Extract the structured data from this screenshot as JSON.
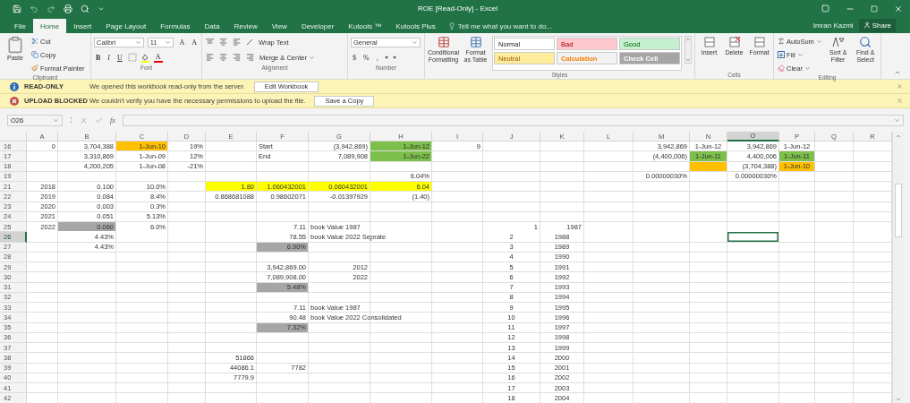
{
  "window": {
    "title": "ROE  [Read-Only] - Excel"
  },
  "tabs": [
    {
      "label": "File",
      "selected": false
    },
    {
      "label": "Home",
      "selected": true
    },
    {
      "label": "Insert",
      "selected": false
    },
    {
      "label": "Page Layout",
      "selected": false
    },
    {
      "label": "Formulas",
      "selected": false
    },
    {
      "label": "Data",
      "selected": false
    },
    {
      "label": "Review",
      "selected": false
    },
    {
      "label": "View",
      "selected": false
    },
    {
      "label": "Developer",
      "selected": false
    },
    {
      "label": "Kutools ™",
      "selected": false
    },
    {
      "label": "Kutools Plus",
      "selected": false
    }
  ],
  "tell_me": {
    "placeholder": "Tell me what you want to do..."
  },
  "user": {
    "name": "Imran Kazmi",
    "share": "Share"
  },
  "ribbon": {
    "clipboard": {
      "label": "Clipboard",
      "paste": "Paste",
      "cut": "Cut",
      "copy": "Copy",
      "format_painter": "Format Painter"
    },
    "font": {
      "label": "Font",
      "name": "Calibri",
      "size": "11",
      "grow": "A",
      "shrink": "A",
      "bold": "B",
      "italic": "I",
      "underline": "U",
      "font_color": "A"
    },
    "alignment": {
      "label": "Alignment",
      "wrap_text": "Wrap Text",
      "merge": "Merge & Center"
    },
    "number": {
      "label": "Number",
      "format": "General",
      "currency": "$",
      "percent": "%",
      "comma": ","
    },
    "styles": {
      "label": "Styles",
      "conditional": "Conditional Formatting",
      "format_table": "Format as Table",
      "cell_styles": [
        {
          "label": "Normal",
          "color": "#ffffff"
        },
        {
          "label": "Bad",
          "color": "#ffc7ce"
        },
        {
          "label": "Good",
          "color": "#c6efce"
        },
        {
          "label": "Neutral",
          "color": "#ffeb9c"
        },
        {
          "label": "Calculation",
          "color": "#f2f2f2"
        },
        {
          "label": "Check Cell",
          "color": "#a5a5a5"
        }
      ]
    },
    "cells": {
      "label": "Cells",
      "buttons": [
        "Insert",
        "Delete",
        "Format"
      ]
    },
    "editing": {
      "label": "Editing",
      "autosum": "AutoSum",
      "fill": "Fill",
      "clear": "Clear",
      "sort": "Sort & Filter",
      "find": "Find & Select"
    }
  },
  "message_bars": [
    {
      "kind": "info",
      "title": "READ-ONLY",
      "message": "We opened this workbook read-only from the server.",
      "button": "Edit Workbook"
    },
    {
      "kind": "error",
      "title": "UPLOAD BLOCKED",
      "message": "We couldn't verify you have the necessary permissions to upload the file.",
      "button": "Save a Copy"
    }
  ],
  "formula_bar": {
    "name_box": "O26",
    "function_label": "fx"
  },
  "sheet": {
    "columns": [
      {
        "label": "A",
        "selected": false
      },
      {
        "label": "B",
        "selected": false
      },
      {
        "label": "C",
        "selected": false
      },
      {
        "label": "D",
        "selected": false
      },
      {
        "label": "E",
        "selected": false
      },
      {
        "label": "F",
        "selected": false
      },
      {
        "label": "G",
        "selected": false
      },
      {
        "label": "H",
        "selected": false
      },
      {
        "label": "I",
        "selected": false
      },
      {
        "label": "J",
        "selected": false
      },
      {
        "label": "K",
        "selected": false
      },
      {
        "label": "L",
        "selected": false
      },
      {
        "label": "M",
        "selected": false
      },
      {
        "label": "N",
        "selected": false
      },
      {
        "label": "O",
        "selected": true
      },
      {
        "label": "P",
        "selected": false
      },
      {
        "label": "Q",
        "selected": false
      },
      {
        "label": "R",
        "selected": false
      }
    ],
    "rows": [
      {
        "number": "16",
        "selected": false,
        "cells": [
          {
            "text": "0",
            "kind": "number"
          },
          {
            "text": "3,704,388",
            "kind": "number"
          },
          {
            "text": "1-Jun-10",
            "kind": "number",
            "color": "#ffc000"
          },
          {
            "text": "19%",
            "kind": "number"
          },
          null,
          {
            "text": "Start",
            "kind": "text"
          },
          {
            "text": "(3,942,869)",
            "kind": "number"
          },
          {
            "text": "1-Jun-12",
            "kind": "number",
            "color": "#7cbf4a"
          },
          {
            "text": "9",
            "kind": "number"
          },
          null,
          null,
          null,
          {
            "text": "3,942,869",
            "kind": "number"
          },
          {
            "text": "1-Jun-12",
            "kind": "center"
          },
          {
            "text": "3,942,869",
            "kind": "number"
          },
          {
            "text": "1-Jun-12",
            "kind": "center"
          }
        ]
      },
      {
        "number": "17",
        "selected": false,
        "cells": [
          null,
          {
            "text": "3,310,869",
            "kind": "number"
          },
          {
            "text": "1-Jun-09",
            "kind": "number"
          },
          {
            "text": "12%",
            "kind": "number"
          },
          null,
          {
            "text": "End",
            "kind": "text"
          },
          {
            "text": "7,089,908",
            "kind": "number"
          },
          {
            "text": "1-Jun-22",
            "kind": "number",
            "color": "#7cbf4a"
          },
          null,
          null,
          null,
          null,
          {
            "text": "(4,400,006)",
            "kind": "number"
          },
          {
            "text": "1-Jun-11",
            "kind": "center",
            "color": "#7cbf4a"
          },
          {
            "text": "4,400,006",
            "kind": "number"
          },
          {
            "text": "1-Jun-11",
            "kind": "center",
            "color": "#7cbf4a"
          }
        ]
      },
      {
        "number": "18",
        "selected": false,
        "cells": [
          null,
          {
            "text": "4,200,205",
            "kind": "number"
          },
          {
            "text": "1-Jun-08",
            "kind": "number"
          },
          {
            "text": "-21%",
            "kind": "number"
          },
          null,
          null,
          null,
          null,
          null,
          null,
          null,
          null,
          null,
          {
            "kind": "number",
            "color": "#ffc000"
          },
          {
            "text": "(3,704,388)",
            "kind": "number"
          },
          {
            "text": "1-Jun-10",
            "kind": "center",
            "color": "#ffc000"
          }
        ]
      },
      {
        "number": "19",
        "selected": false,
        "cells": [
          null,
          null,
          null,
          null,
          null,
          null,
          null,
          {
            "text": "6.04%",
            "kind": "number"
          },
          null,
          null,
          null,
          null,
          {
            "text": "0.00000030%",
            "kind": "number"
          },
          null,
          {
            "text": "0.00000030%",
            "kind": "number"
          }
        ]
      },
      {
        "number": "21",
        "selected": false,
        "cells": [
          {
            "text": "2018",
            "kind": "number"
          },
          {
            "text": "0.100",
            "kind": "number"
          },
          {
            "text": "10.0%",
            "kind": "number"
          },
          null,
          {
            "text": "1.80",
            "kind": "number",
            "color": "#ffff00"
          },
          {
            "text": "1.060432001",
            "kind": "number",
            "color": "#ffff00"
          },
          {
            "text": "0.060432001",
            "kind": "number",
            "color": "#ffff00"
          },
          {
            "text": "6.04",
            "kind": "number",
            "color": "#ffff00"
          }
        ]
      },
      {
        "number": "22",
        "selected": false,
        "cells": [
          {
            "text": "2019",
            "kind": "number"
          },
          {
            "text": "0.084",
            "kind": "number"
          },
          {
            "text": "8.4%",
            "kind": "number"
          },
          null,
          {
            "text": "0.868681088",
            "kind": "number"
          },
          {
            "text": "0.98602071",
            "kind": "number"
          },
          {
            "text": "-0.01397929",
            "kind": "number"
          },
          {
            "text": "(1.40)",
            "kind": "number"
          }
        ]
      },
      {
        "number": "23",
        "selected": false,
        "cells": [
          {
            "text": "2020",
            "kind": "number"
          },
          {
            "text": "0.003",
            "kind": "number"
          },
          {
            "text": "0.3%",
            "kind": "number"
          }
        ]
      },
      {
        "number": "24",
        "selected": false,
        "cells": [
          {
            "text": "2021",
            "kind": "number"
          },
          {
            "text": "0.051",
            "kind": "number"
          },
          {
            "text": "5.13%",
            "kind": "number"
          }
        ]
      },
      {
        "number": "25",
        "selected": false,
        "cells": [
          {
            "text": "2022",
            "kind": "number"
          },
          {
            "text": "0.060",
            "kind": "number",
            "color": "#a6a6a6"
          },
          {
            "text": "6.0%",
            "kind": "number"
          },
          null,
          null,
          {
            "text": "7.11",
            "kind": "number"
          },
          {
            "text": "book Value 1987",
            "kind": "text"
          },
          null,
          null,
          {
            "text": "1",
            "kind": "number"
          },
          {
            "text": "1987",
            "kind": "number"
          }
        ]
      },
      {
        "number": "26",
        "selected": true,
        "cells": [
          null,
          {
            "text": "4.43%",
            "kind": "number"
          },
          null,
          null,
          null,
          {
            "text": "78.55",
            "kind": "number"
          },
          {
            "text": "book Value 2022 Seprate",
            "kind": "text"
          },
          null,
          null,
          {
            "text": "2",
            "kind": "center"
          },
          {
            "text": "1988",
            "kind": "center"
          },
          null,
          null,
          null,
          {
            "kind": "text",
            "selected": true
          }
        ]
      },
      {
        "number": "27",
        "selected": false,
        "cells": [
          null,
          {
            "text": "4.43%",
            "kind": "number"
          },
          null,
          null,
          null,
          {
            "text": "6.90%",
            "kind": "number",
            "color": "#a6a6a6"
          },
          null,
          null,
          null,
          {
            "text": "3",
            "kind": "center"
          },
          {
            "text": "1989",
            "kind": "center"
          }
        ]
      },
      {
        "number": "28",
        "selected": false,
        "cells": [
          null,
          null,
          null,
          null,
          null,
          null,
          null,
          null,
          null,
          {
            "text": "4",
            "kind": "center"
          },
          {
            "text": "1990",
            "kind": "center"
          }
        ]
      },
      {
        "number": "29",
        "selected": false,
        "cells": [
          null,
          null,
          null,
          null,
          null,
          {
            "text": "3,942,869.00",
            "kind": "number"
          },
          {
            "text": "2012",
            "kind": "number"
          },
          null,
          null,
          {
            "text": "5",
            "kind": "center"
          },
          {
            "text": "1991",
            "kind": "center"
          }
        ]
      },
      {
        "number": "30",
        "selected": false,
        "cells": [
          null,
          null,
          null,
          null,
          null,
          {
            "text": "7,089,908.00",
            "kind": "number"
          },
          {
            "text": "2022",
            "kind": "number"
          },
          null,
          null,
          {
            "text": "6",
            "kind": "center"
          },
          {
            "text": "1992",
            "kind": "center"
          }
        ]
      },
      {
        "number": "31",
        "selected": false,
        "cells": [
          null,
          null,
          null,
          null,
          null,
          {
            "text": "5.48%",
            "kind": "number",
            "color": "#a6a6a6"
          },
          null,
          null,
          null,
          {
            "text": "7",
            "kind": "center"
          },
          {
            "text": "1993",
            "kind": "center"
          }
        ]
      },
      {
        "number": "32",
        "selected": false,
        "cells": [
          null,
          null,
          null,
          null,
          null,
          null,
          null,
          null,
          null,
          {
            "text": "8",
            "kind": "center"
          },
          {
            "text": "1994",
            "kind": "center"
          }
        ]
      },
      {
        "number": "33",
        "selected": false,
        "cells": [
          null,
          null,
          null,
          null,
          null,
          {
            "text": "7.11",
            "kind": "number"
          },
          {
            "text": "book Value 1987",
            "kind": "text"
          },
          null,
          null,
          {
            "text": "9",
            "kind": "center"
          },
          {
            "text": "1995",
            "kind": "center"
          }
        ]
      },
      {
        "number": "34",
        "selected": false,
        "cells": [
          null,
          null,
          null,
          null,
          null,
          {
            "text": "90.48",
            "kind": "number"
          },
          {
            "text": "book Value 2022 Consolidated",
            "kind": "text"
          },
          null,
          null,
          {
            "text": "10",
            "kind": "center"
          },
          {
            "text": "1996",
            "kind": "center"
          }
        ]
      },
      {
        "number": "35",
        "selected": false,
        "cells": [
          null,
          null,
          null,
          null,
          null,
          {
            "text": "7.32%",
            "kind": "number",
            "color": "#a6a6a6"
          },
          null,
          null,
          null,
          {
            "text": "11",
            "kind": "center"
          },
          {
            "text": "1997",
            "kind": "center"
          }
        ]
      },
      {
        "number": "36",
        "selected": false,
        "cells": [
          null,
          null,
          null,
          null,
          null,
          null,
          null,
          null,
          null,
          {
            "text": "12",
            "kind": "center"
          },
          {
            "text": "1998",
            "kind": "center"
          }
        ]
      },
      {
        "number": "37",
        "selected": false,
        "cells": [
          null,
          null,
          null,
          null,
          null,
          null,
          null,
          null,
          null,
          {
            "text": "13",
            "kind": "center"
          },
          {
            "text": "1999",
            "kind": "center"
          }
        ]
      },
      {
        "number": "38",
        "selected": false,
        "cells": [
          null,
          null,
          null,
          null,
          {
            "text": "51866",
            "kind": "number"
          },
          null,
          null,
          null,
          null,
          {
            "text": "14",
            "kind": "center"
          },
          {
            "text": "2000",
            "kind": "center"
          }
        ]
      },
      {
        "number": "39",
        "selected": false,
        "cells": [
          null,
          null,
          null,
          null,
          {
            "text": "44086.1",
            "kind": "number"
          },
          {
            "text": "7782",
            "kind": "number"
          },
          null,
          null,
          null,
          {
            "text": "15",
            "kind": "center"
          },
          {
            "text": "2001",
            "kind": "center"
          }
        ]
      },
      {
        "number": "40",
        "selected": false,
        "cells": [
          null,
          null,
          null,
          null,
          {
            "text": "7779.9",
            "kind": "number"
          },
          null,
          null,
          null,
          null,
          {
            "text": "16",
            "kind": "center"
          },
          {
            "text": "2002",
            "kind": "center"
          }
        ]
      },
      {
        "number": "41",
        "selected": false,
        "cells": [
          null,
          null,
          null,
          null,
          null,
          null,
          null,
          null,
          null,
          {
            "text": "17",
            "kind": "center"
          },
          {
            "text": "2003",
            "kind": "center"
          }
        ]
      },
      {
        "number": "42",
        "selected": false,
        "cells": [
          null,
          null,
          null,
          null,
          null,
          null,
          null,
          null,
          null,
          {
            "text": "18",
            "kind": "center"
          },
          {
            "text": "2004",
            "kind": "center"
          }
        ]
      }
    ]
  }
}
